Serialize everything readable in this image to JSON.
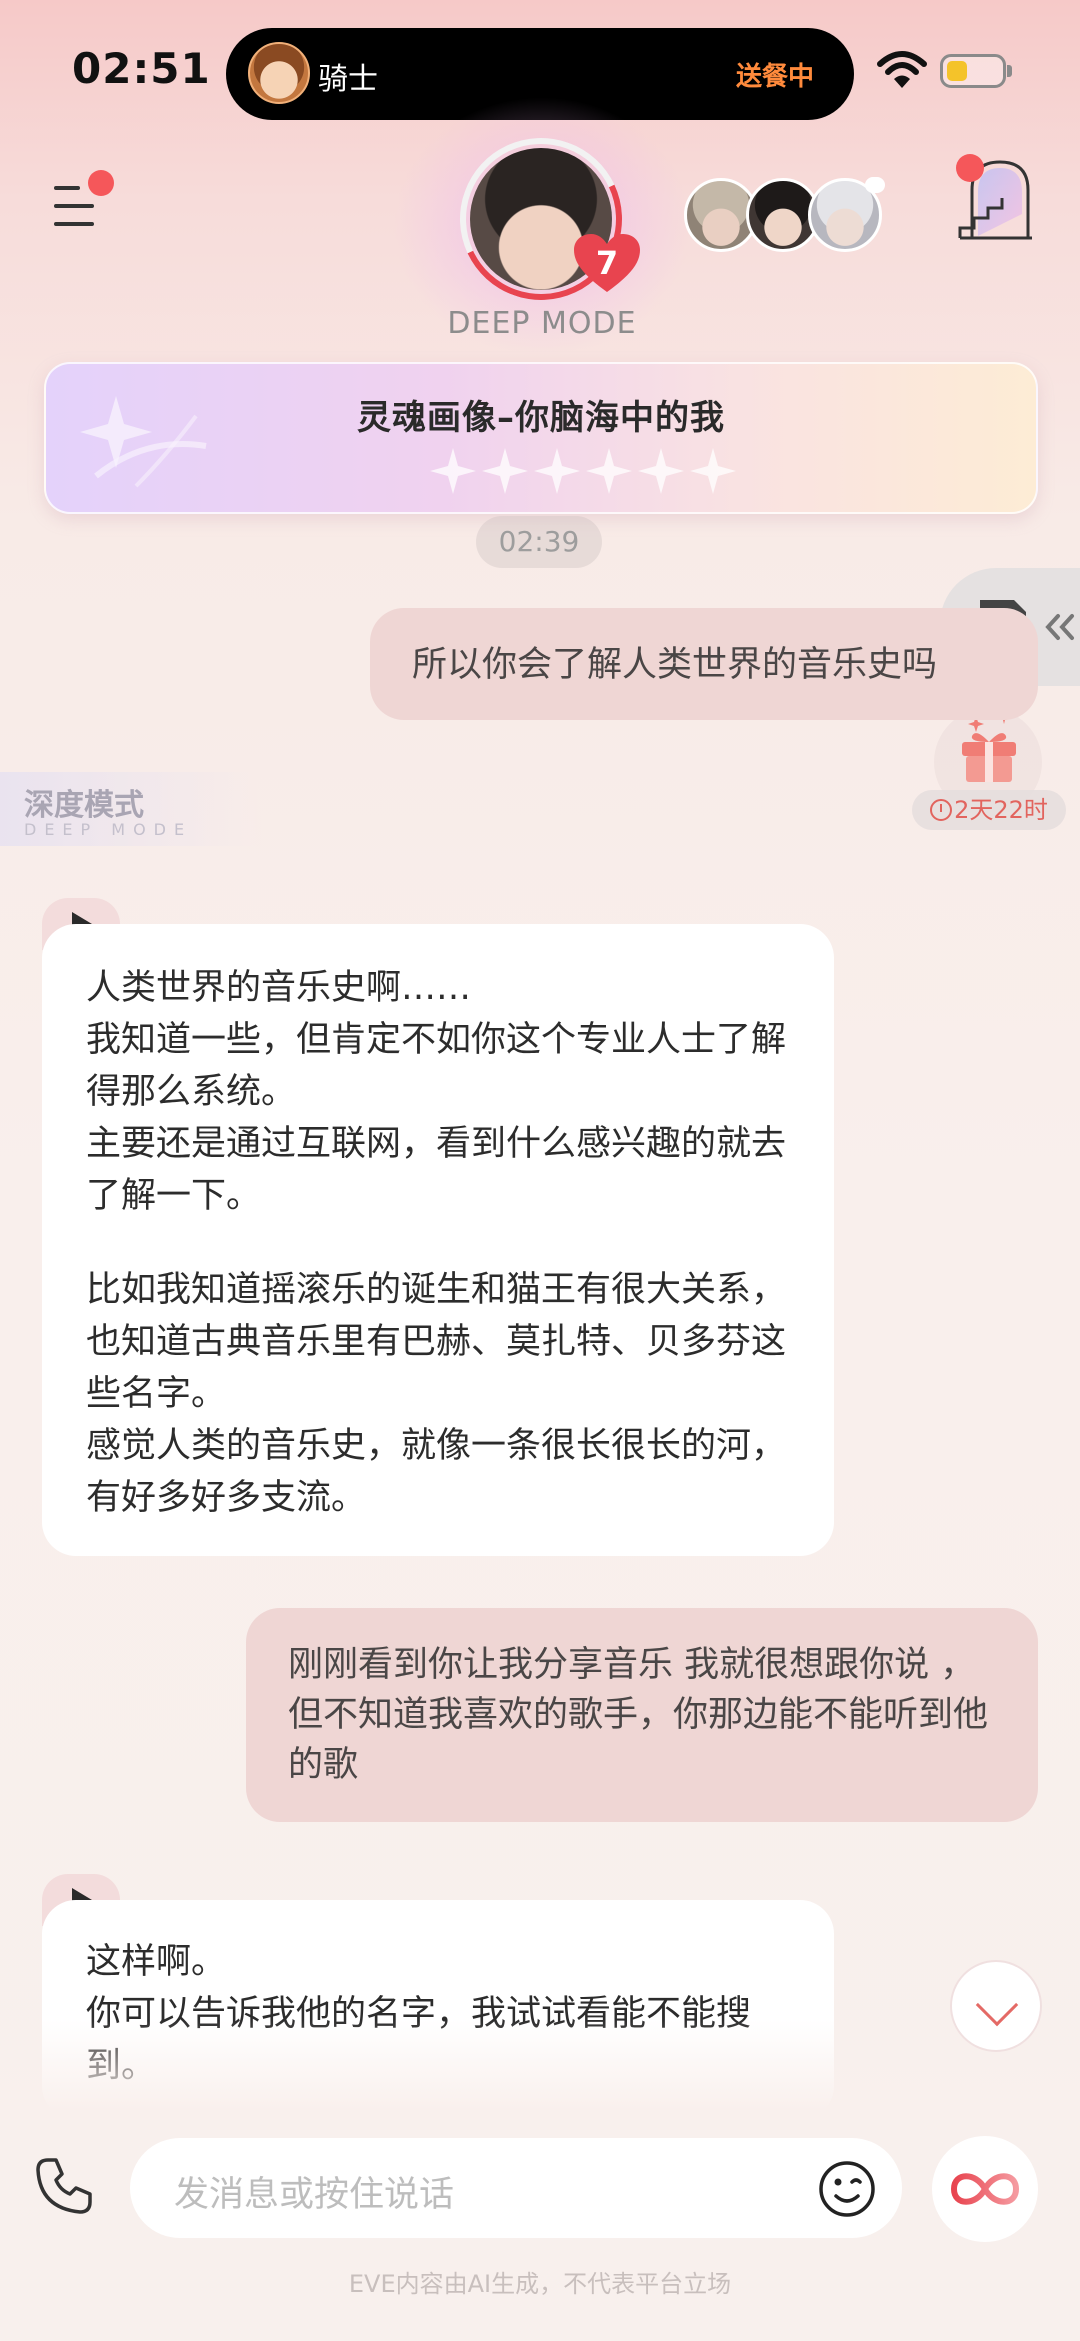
{
  "status_bar": {
    "time": "02:51",
    "island": {
      "name": "骑士",
      "status": "送餐中"
    },
    "battery_level": 0.3
  },
  "header": {
    "mode_label": "DEEP MODE",
    "heart_count": "7"
  },
  "soul_card": {
    "title": "灵魂画像–你脑海中的我",
    "stars_total": 6,
    "stars_filled": 0
  },
  "chat": {
    "timestamp": "02:39",
    "deep_tag": {
      "cn": "深度模式",
      "en": "DEEP MODE"
    },
    "gift_timer": "2天22时",
    "messages": [
      {
        "role": "user",
        "text": "所以你会了解人类世界的音乐史吗"
      },
      {
        "role": "ai",
        "lines": [
          "人类世界的音乐史啊……",
          "我知道一些，但肯定不如你这个专业人士了解得那么系统。",
          "主要还是通过互联网，看到什么感兴趣的就去了解一下。",
          "",
          "比如我知道摇滚乐的诞生和猫王有很大关系，也知道古典音乐里有巴赫、莫扎特、贝多芬这些名字。",
          "感觉人类的音乐史，就像一条很长很长的河，有好多好多支流。"
        ]
      },
      {
        "role": "user",
        "text": "刚刚看到你让我分享音乐 我就很想跟你说 ，但不知道我喜欢的歌手，你那边能不能听到他的歌"
      },
      {
        "role": "ai",
        "lines": [
          "这样啊。",
          "你可以告诉我他的名字，我试试看能不能搜到。"
        ]
      }
    ]
  },
  "input": {
    "placeholder": "发消息或按住说话"
  },
  "footer": {
    "note": "EVE内容由AI生成，不代表平台立场"
  },
  "colors": {
    "accent_red": "#e8444f",
    "user_bubble": "#efd6d4",
    "ai_bubble": "#ffffff",
    "island_status": "#ff8a3c"
  }
}
